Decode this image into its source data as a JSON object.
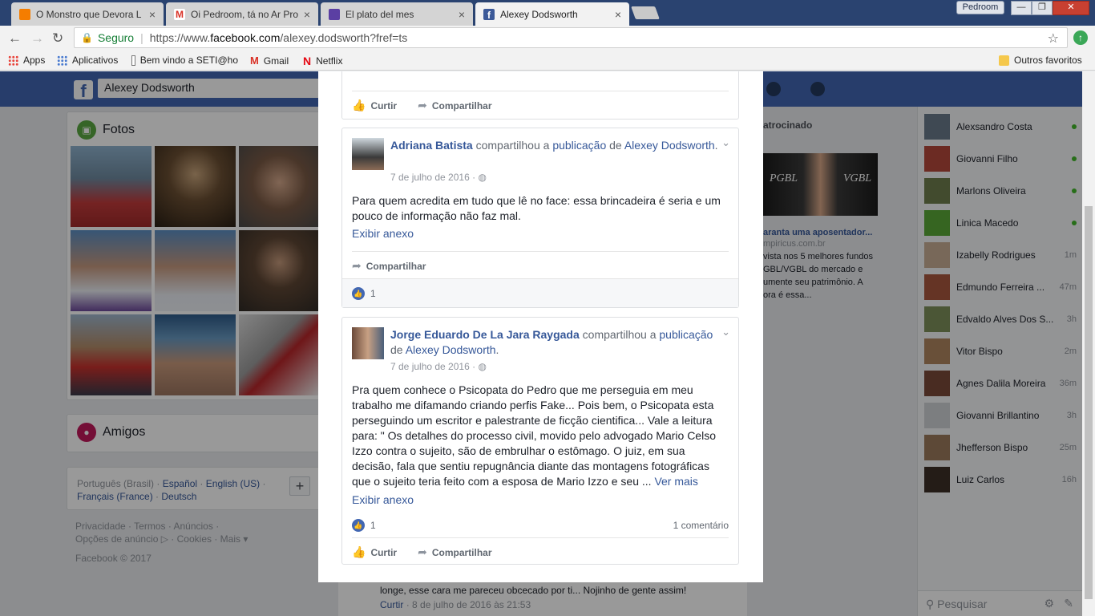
{
  "browser": {
    "tabs": [
      {
        "title": "O Monstro que Devora L",
        "color": "#f57d00"
      },
      {
        "title": "Oi Pedroom, tá no Ar Pro",
        "color": "#d93025"
      },
      {
        "title": "El plato del mes",
        "color": "#5b3fa3"
      },
      {
        "title": "Alexey Dodsworth",
        "color": "#3b5998"
      }
    ],
    "user_label": "Pedroom",
    "secure_label": "Seguro",
    "url_prefix": "https://www.",
    "url_domain": "facebook.com",
    "url_path": "/alexey.dodsworth?fref=ts",
    "bookmarks": [
      "Apps",
      "Aplicativos",
      "Bem vindo a SETI@ho",
      "Gmail",
      "Netflix"
    ],
    "other_bookmarks": "Outros favoritos"
  },
  "facebook": {
    "search_value": "Alexey Dodsworth",
    "photos_title": "Fotos",
    "friends_title": "Amigos",
    "languages": {
      "line1": "Português (Brasil)",
      "l2": "Español",
      "l3": "English (US)",
      "l4": "Français (France)",
      "l5": "Deutsch"
    },
    "footer": {
      "line1": "Privacidade · Termos · Anúncios ·",
      "line2": "Opções de anúncio ▷ · Cookies · Mais ▾",
      "copyright": "Facebook © 2017"
    },
    "sponsored": {
      "label": "atrocinado",
      "img_left": "PGBL",
      "img_right": "VGBL",
      "headline": "aranta uma aposentador...",
      "domain": "mpiricus.com.br",
      "desc": "vista nos 5 melhores fundos GBL/VGBL do mercado e umente seu patrimônio. A ora é essa..."
    },
    "chat": {
      "contacts": [
        {
          "name": "Alexsandro Costa",
          "status": "online"
        },
        {
          "name": "Giovanni Filho",
          "status": "online"
        },
        {
          "name": "Marlons Oliveira",
          "status": "online"
        },
        {
          "name": "Linica Macedo",
          "status": "online"
        },
        {
          "name": "Izabelly Rodrigues",
          "status": "1m"
        },
        {
          "name": "Edmundo Ferreira ...",
          "status": "47m"
        },
        {
          "name": "Edvaldo Alves Dos S...",
          "status": "3h"
        },
        {
          "name": "Vitor Bispo",
          "status": "2m"
        },
        {
          "name": "Agnes Dalila Moreira",
          "status": "36m"
        },
        {
          "name": "Giovanni Brillantino",
          "status": "3h"
        },
        {
          "name": "Jhefferson Bispo",
          "status": "25m"
        },
        {
          "name": "Luiz Carlos",
          "status": "16h"
        }
      ],
      "search_placeholder": "Pesquisar"
    },
    "background_comment": {
      "text": "longe, esse cara me pareceu obcecado por ti... Nojinho de gente assim!",
      "curtir": "Curtir",
      "time": "· 8 de julho de 2016 às 21:53"
    }
  },
  "modal": {
    "top_actions": {
      "like": "Curtir",
      "share": "Compartilhar"
    },
    "posts": [
      {
        "author": "Adriana Batista",
        "verb": "compartilhou a",
        "link1": "publicação",
        "prep": "de",
        "link2": "Alexey Dodsworth",
        "date": "7 de julho de 2016 ·",
        "text": "Para quem acredita em tudo que lê no face: essa brincadeira é seria e um pouco de informação não faz mal.",
        "anexo": "Exibir anexo",
        "share": "Compartilhar",
        "likes": "1"
      },
      {
        "author": "Jorge Eduardo De La Jara Raygada",
        "verb": "compartilhou a",
        "link1": "publicação",
        "prep": "de",
        "link2": "Alexey Dodsworth",
        "date": "7 de julho de 2016 ·",
        "text": "Pra quem conhece o Psicopata do Pedro que me perseguia em meu trabalho me difamando criando perfis Fake... Pois bem, o Psicopata esta perseguindo um escritor e palestrante de ficção cientifica... Vale a leitura para: \" Os detalhes do processo civil, movido pelo advogado Mario Celso Izzo contra o sujeito, são de embrulhar o estômago. O juiz, em sua decisão, fala que sentiu repugnância diante das montagens fotográficas que o sujeito teria feito com a esposa de Mario Izzo e seu ...",
        "more": "Ver mais",
        "anexo": "Exibir anexo",
        "likes": "1",
        "comments": "1 comentário",
        "like_label": "Curtir",
        "share": "Compartilhar"
      }
    ]
  }
}
